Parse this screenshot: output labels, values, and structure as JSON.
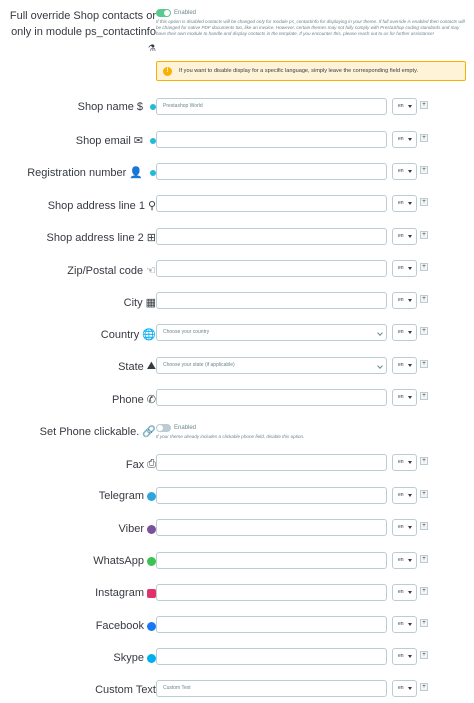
{
  "override": {
    "label_line1": "Full override Shop contacts or",
    "label_line2": "only in module ps_contactinfo",
    "toggle_label": "Enabled",
    "help": "If this option is disabled contacts will be changed only for module ps_contactinfo for displaying in your theme. If full override is enabled then contacts will be changed for native PDF documents too, like an invoice. However, certain themes may not fully comply with PrestaShop coding standards and may have their own module to handle and display contacts in the template. If you encounter this, please reach out to us for further assistance!",
    "accent_color": "#59c98f"
  },
  "alert": {
    "text": "If you want to disable display for a specific language, simply leave the corresponding field empty.",
    "icon": "warning-icon",
    "color": "#fab000"
  },
  "fields": {
    "shop_name": {
      "label": "Shop name",
      "value": "Prestashop World",
      "lang": "en"
    },
    "shop_email": {
      "label": "Shop email",
      "value": "",
      "lang": "en"
    },
    "registration_number": {
      "label": "Registration number",
      "value": "",
      "lang": "en"
    },
    "address1": {
      "label": "Shop address line 1",
      "value": "",
      "lang": "en"
    },
    "address2": {
      "label": "Shop address line 2",
      "value": "",
      "lang": "en"
    },
    "zip": {
      "label": "Zip/Postal code",
      "value": "",
      "lang": "en"
    },
    "city": {
      "label": "City",
      "value": "",
      "lang": "en"
    },
    "country": {
      "label": "Country",
      "placeholder": "Choose your country",
      "lang": "en"
    },
    "state": {
      "label": "State",
      "placeholder": "Choose your state (if applicable)",
      "lang": "en"
    },
    "phone": {
      "label": "Phone",
      "value": "",
      "lang": "en"
    },
    "fax": {
      "label": "Fax",
      "value": "",
      "lang": "en"
    },
    "telegram": {
      "label": "Telegram",
      "value": "",
      "lang": "en"
    },
    "viber": {
      "label": "Viber",
      "value": "",
      "lang": "en"
    },
    "whatsapp": {
      "label": "WhatsApp",
      "value": "",
      "lang": "en"
    },
    "instagram": {
      "label": "Instagram",
      "value": "",
      "lang": "en"
    },
    "facebook": {
      "label": "Facebook",
      "value": "",
      "lang": "en"
    },
    "skype": {
      "label": "Skype",
      "value": "",
      "lang": "en"
    },
    "custom_text": {
      "label": "Custom Text",
      "value": "Custom Text",
      "lang": "en"
    }
  },
  "phone_clickable": {
    "label": "Set Phone clickable.",
    "toggle_label": "Enabled",
    "help": "If your theme already includes a clickable phone field, disable this option."
  },
  "plus_label": "+"
}
